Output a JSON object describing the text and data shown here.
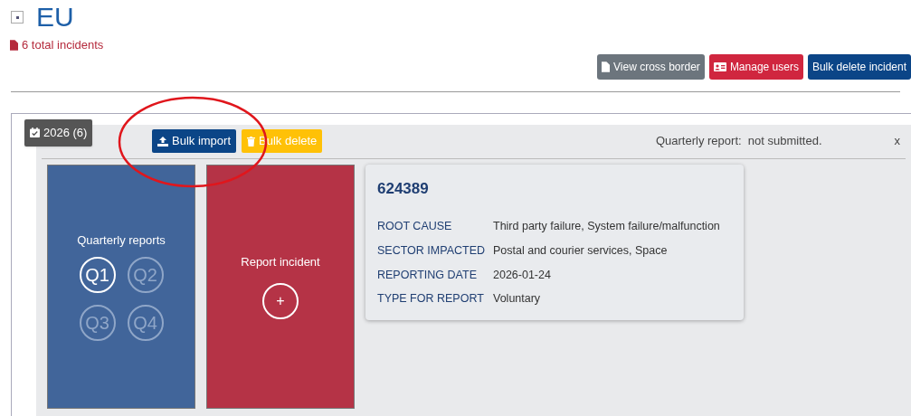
{
  "header": {
    "title": "EU",
    "incident_count": "6 total incidents"
  },
  "actions": [
    {
      "label": "View cross border",
      "kind": "secondary"
    },
    {
      "label": "Manage users",
      "kind": "danger"
    },
    {
      "label": "Bulk delete incident",
      "kind": "primary"
    }
  ],
  "year_panel": {
    "badge": "2026 (6)",
    "toolbar": [
      {
        "label": "Bulk import",
        "kind": "import"
      },
      {
        "label": "Bulk delete",
        "kind": "delete"
      }
    ],
    "status": "Quarterly report:  not submitted.",
    "close": "x",
    "quarterly": {
      "title": "Quarterly reports",
      "quarters": [
        {
          "label": "Q1",
          "selected": true
        },
        {
          "label": "Q2",
          "selected": false
        },
        {
          "label": "Q3",
          "selected": false
        },
        {
          "label": "Q4",
          "selected": false
        }
      ]
    },
    "report": {
      "title": "Report incident",
      "add": "+"
    },
    "incident": {
      "id": "624389",
      "fields": [
        {
          "label": "ROOT CAUSE",
          "value": "Third party failure, System failure/malfunction"
        },
        {
          "label": "SECTOR IMPACTED",
          "value": "Postal and courier services, Space"
        },
        {
          "label": "REPORTING DATE",
          "value": "2026-01-24"
        },
        {
          "label": "TYPE FOR REPORT",
          "value": "Voluntary"
        }
      ]
    }
  }
}
